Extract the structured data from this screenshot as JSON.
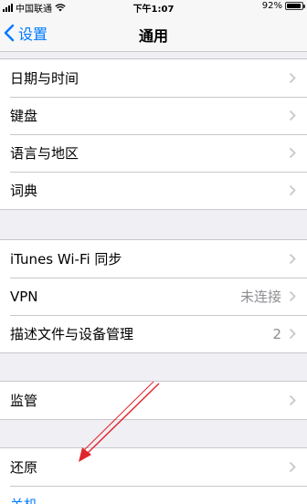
{
  "status_bar": {
    "carrier": "中国联通",
    "time": "下午1:07",
    "battery": "92%",
    "battery_level": 0.92
  },
  "nav": {
    "back_label": "设置",
    "title": "通用"
  },
  "sections": [
    {
      "rows": [
        {
          "label": "日期与时间"
        },
        {
          "label": "键盘"
        },
        {
          "label": "语言与地区"
        },
        {
          "label": "词典"
        }
      ]
    },
    {
      "rows": [
        {
          "label": "iTunes Wi-Fi 同步"
        },
        {
          "label": "VPN",
          "value": "未连接"
        },
        {
          "label": "描述文件与设备管理",
          "value": "2"
        }
      ]
    },
    {
      "rows": [
        {
          "label": "监管"
        }
      ]
    },
    {
      "rows": [
        {
          "label": "还原"
        },
        {
          "label": "关机"
        }
      ]
    }
  ],
  "colors": {
    "accent": "#007aff",
    "annotation_arrow": "#e0242b"
  }
}
